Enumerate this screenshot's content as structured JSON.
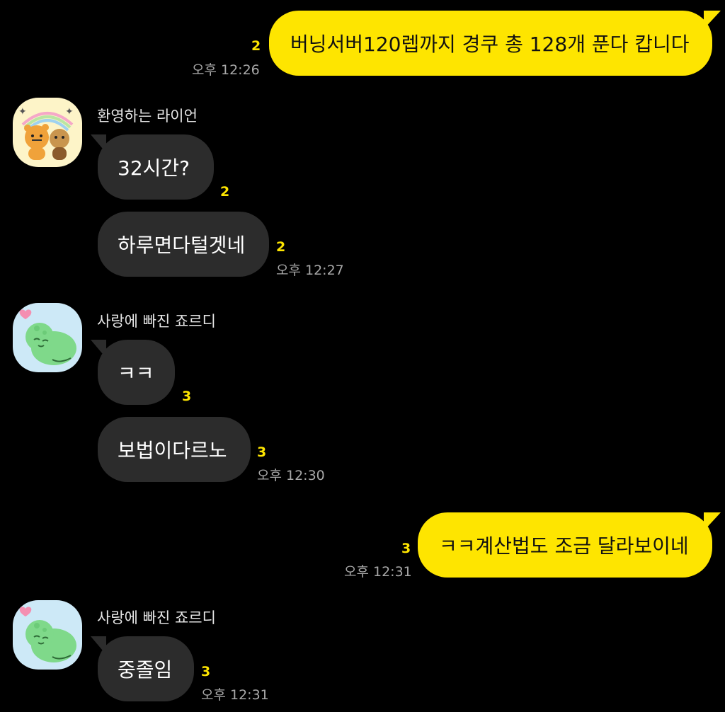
{
  "colors": {
    "background": "#000000",
    "my_bubble": "#fee500",
    "other_bubble": "#2c2c2c",
    "read_count": "#fee500",
    "timestamp": "#a8a8a8"
  },
  "messages": {
    "m1": {
      "text": "버닝서버120렙까지  경쿠 총 128개 푼다 캅니다",
      "unread": "2",
      "time": "오후 12:26"
    },
    "ryan": {
      "sender": "환영하는 라이언",
      "avatar_icon": "ryan-character-icon"
    },
    "m2": {
      "text": "32시간?",
      "unread": "2"
    },
    "m3": {
      "text": "하루면다털겟네",
      "unread": "2",
      "time": "오후 12:27"
    },
    "jordy1": {
      "sender": "사랑에 빠진 죠르디",
      "avatar_icon": "jordy-character-icon"
    },
    "m4": {
      "text": "ㅋㅋ",
      "unread": "3"
    },
    "m5": {
      "text": "보법이다르노",
      "unread": "3",
      "time": "오후 12:30"
    },
    "m6": {
      "text": "ㅋㅋ계산법도 조금 달라보이네",
      "unread": "3",
      "time": "오후 12:31"
    },
    "jordy2": {
      "sender": "사랑에 빠진 죠르디",
      "avatar_icon": "jordy-character-icon"
    },
    "m7": {
      "text": "중졸임",
      "unread": "3",
      "time": "오후 12:31"
    }
  }
}
